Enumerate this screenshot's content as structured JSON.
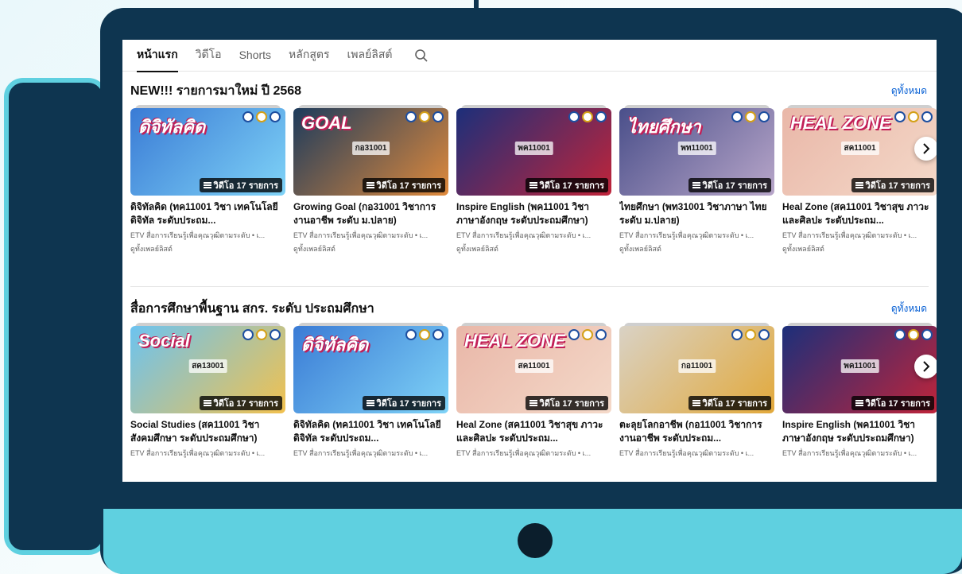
{
  "tabs": [
    {
      "label": "หน้าแรก",
      "active": true
    },
    {
      "label": "วิดีโอ",
      "active": false
    },
    {
      "label": "Shorts",
      "active": false
    },
    {
      "label": "หลักสูตร",
      "active": false
    },
    {
      "label": "เพลย์ลิสต์",
      "active": false
    }
  ],
  "sections": [
    {
      "title": "NEW!!! รายการมาใหม่ ปี 2568",
      "view_all": "ดูทั้งหมด",
      "cards": [
        {
          "thumb_title": "ดิจิทัลคิด",
          "thumb_code": "",
          "badge": "วิดีโอ 17 รายการ",
          "title": "ดิจิทัลคิด (ทค11001 วิชา เทคโนโลยีดิจิทัล ระดับประถม...",
          "meta": "ETV สื่อการเรียนรู้เพื่อคุณวุฒิตามระดับ • เ...",
          "link": "ดูทั้งเพลย์ลิสต์",
          "color_a": "#3a7bd5",
          "color_b": "#7fd3f7"
        },
        {
          "thumb_title": "GOAL",
          "thumb_code": "กอ31001",
          "badge": "วิดีโอ 17 รายการ",
          "title": "Growing Goal (กอ31001 วิชาการงานอาชีพ ระดับ ม.ปลาย)",
          "meta": "ETV สื่อการเรียนรู้เพื่อคุณวุฒิตามระดับ • เ...",
          "link": "ดูทั้งเพลย์ลิสต์",
          "color_a": "#1d3b5c",
          "color_b": "#e08a3c"
        },
        {
          "thumb_title": "",
          "thumb_code": "พค11001",
          "badge": "วิดีโอ 17 รายการ",
          "title": "Inspire English (พค11001 วิชา ภาษาอังกฤษ ระดับประถมศึกษา)",
          "meta": "ETV สื่อการเรียนรู้เพื่อคุณวุฒิตามระดับ • เ...",
          "link": "ดูทั้งเพลย์ลิสต์",
          "color_a": "#1c2f7a",
          "color_b": "#c0243a"
        },
        {
          "thumb_title": "ไทยศึกษา",
          "thumb_code": "พท11001",
          "badge": "วิดีโอ 17 รายการ",
          "title": "ไทยศึกษา (พท31001 วิชาภาษา ไทย ระดับ ม.ปลาย)",
          "meta": "ETV สื่อการเรียนรู้เพื่อคุณวุฒิตามระดับ • เ...",
          "link": "ดูทั้งเพลย์ลิสต์",
          "color_a": "#4a4f8a",
          "color_b": "#b8a6c9"
        },
        {
          "thumb_title": "HEAL ZONE",
          "thumb_code": "สค11001",
          "badge": "วิดีโอ 17 รายการ",
          "title": "Heal Zone (สค11001 วิชาสุข ภาวะและศิลปะ ระดับประถม...",
          "meta": "ETV สื่อการเรียนรู้เพื่อคุณวุฒิตามระดับ • เ...",
          "link": "ดูทั้งเพลย์ลิสต์",
          "color_a": "#e9b7a8",
          "color_b": "#f4d9c9"
        }
      ]
    },
    {
      "title": "สื่อการศึกษาพื้นฐาน สกร. ระดับ ประถมศึกษา",
      "view_all": "ดูทั้งหมด",
      "cards": [
        {
          "thumb_title": "Social",
          "thumb_code": "สค13001",
          "badge": "วิดีโอ 17 รายการ",
          "title": "Social Studies (สค11001 วิชา สังคมศึกษา ระดับประถมศึกษา)",
          "meta": "ETV สื่อการเรียนรู้เพื่อคุณวุฒิตามระดับ • เ...",
          "link": "",
          "color_a": "#6cc3f0",
          "color_b": "#f2c14e"
        },
        {
          "thumb_title": "ดิจิทัลคิด",
          "thumb_code": "",
          "badge": "วิดีโอ 17 รายการ",
          "title": "ดิจิทัลคิด (ทค11001 วิชา เทคโนโลยีดิจิทัล ระดับประถม...",
          "meta": "ETV สื่อการเรียนรู้เพื่อคุณวุฒิตามระดับ • เ...",
          "link": "",
          "color_a": "#3a7bd5",
          "color_b": "#7fd3f7"
        },
        {
          "thumb_title": "HEAL ZONE",
          "thumb_code": "สค11001",
          "badge": "วิดีโอ 17 รายการ",
          "title": "Heal Zone (สค11001 วิชาสุข ภาวะและศิลปะ ระดับประถม...",
          "meta": "ETV สื่อการเรียนรู้เพื่อคุณวุฒิตามระดับ • เ...",
          "link": "",
          "color_a": "#e9b7a8",
          "color_b": "#f4d9c9"
        },
        {
          "thumb_title": "",
          "thumb_code": "กอ11001",
          "badge": "วิดีโอ 17 รายการ",
          "title": "ตะลุยโลกอาชีพ (กอ11001 วิชาการงานอาชีพ ระดับประถม...",
          "meta": "ETV สื่อการเรียนรู้เพื่อคุณวุฒิตามระดับ • เ...",
          "link": "",
          "color_a": "#d9d2c5",
          "color_b": "#e2a93b"
        },
        {
          "thumb_title": "",
          "thumb_code": "พค11001",
          "badge": "วิดีโอ 17 รายการ",
          "title": "Inspire English (พค11001 วิชา ภาษาอังกฤษ ระดับประถมศึกษา)",
          "meta": "ETV สื่อการเรียนรู้เพื่อคุณวุฒิตามระดับ • เ...",
          "link": "",
          "color_a": "#1c2f7a",
          "color_b": "#c0243a"
        }
      ]
    }
  ],
  "colors": {
    "link": "#065fd4",
    "monitor": "#0e3550",
    "accent": "#5fd0e0"
  }
}
